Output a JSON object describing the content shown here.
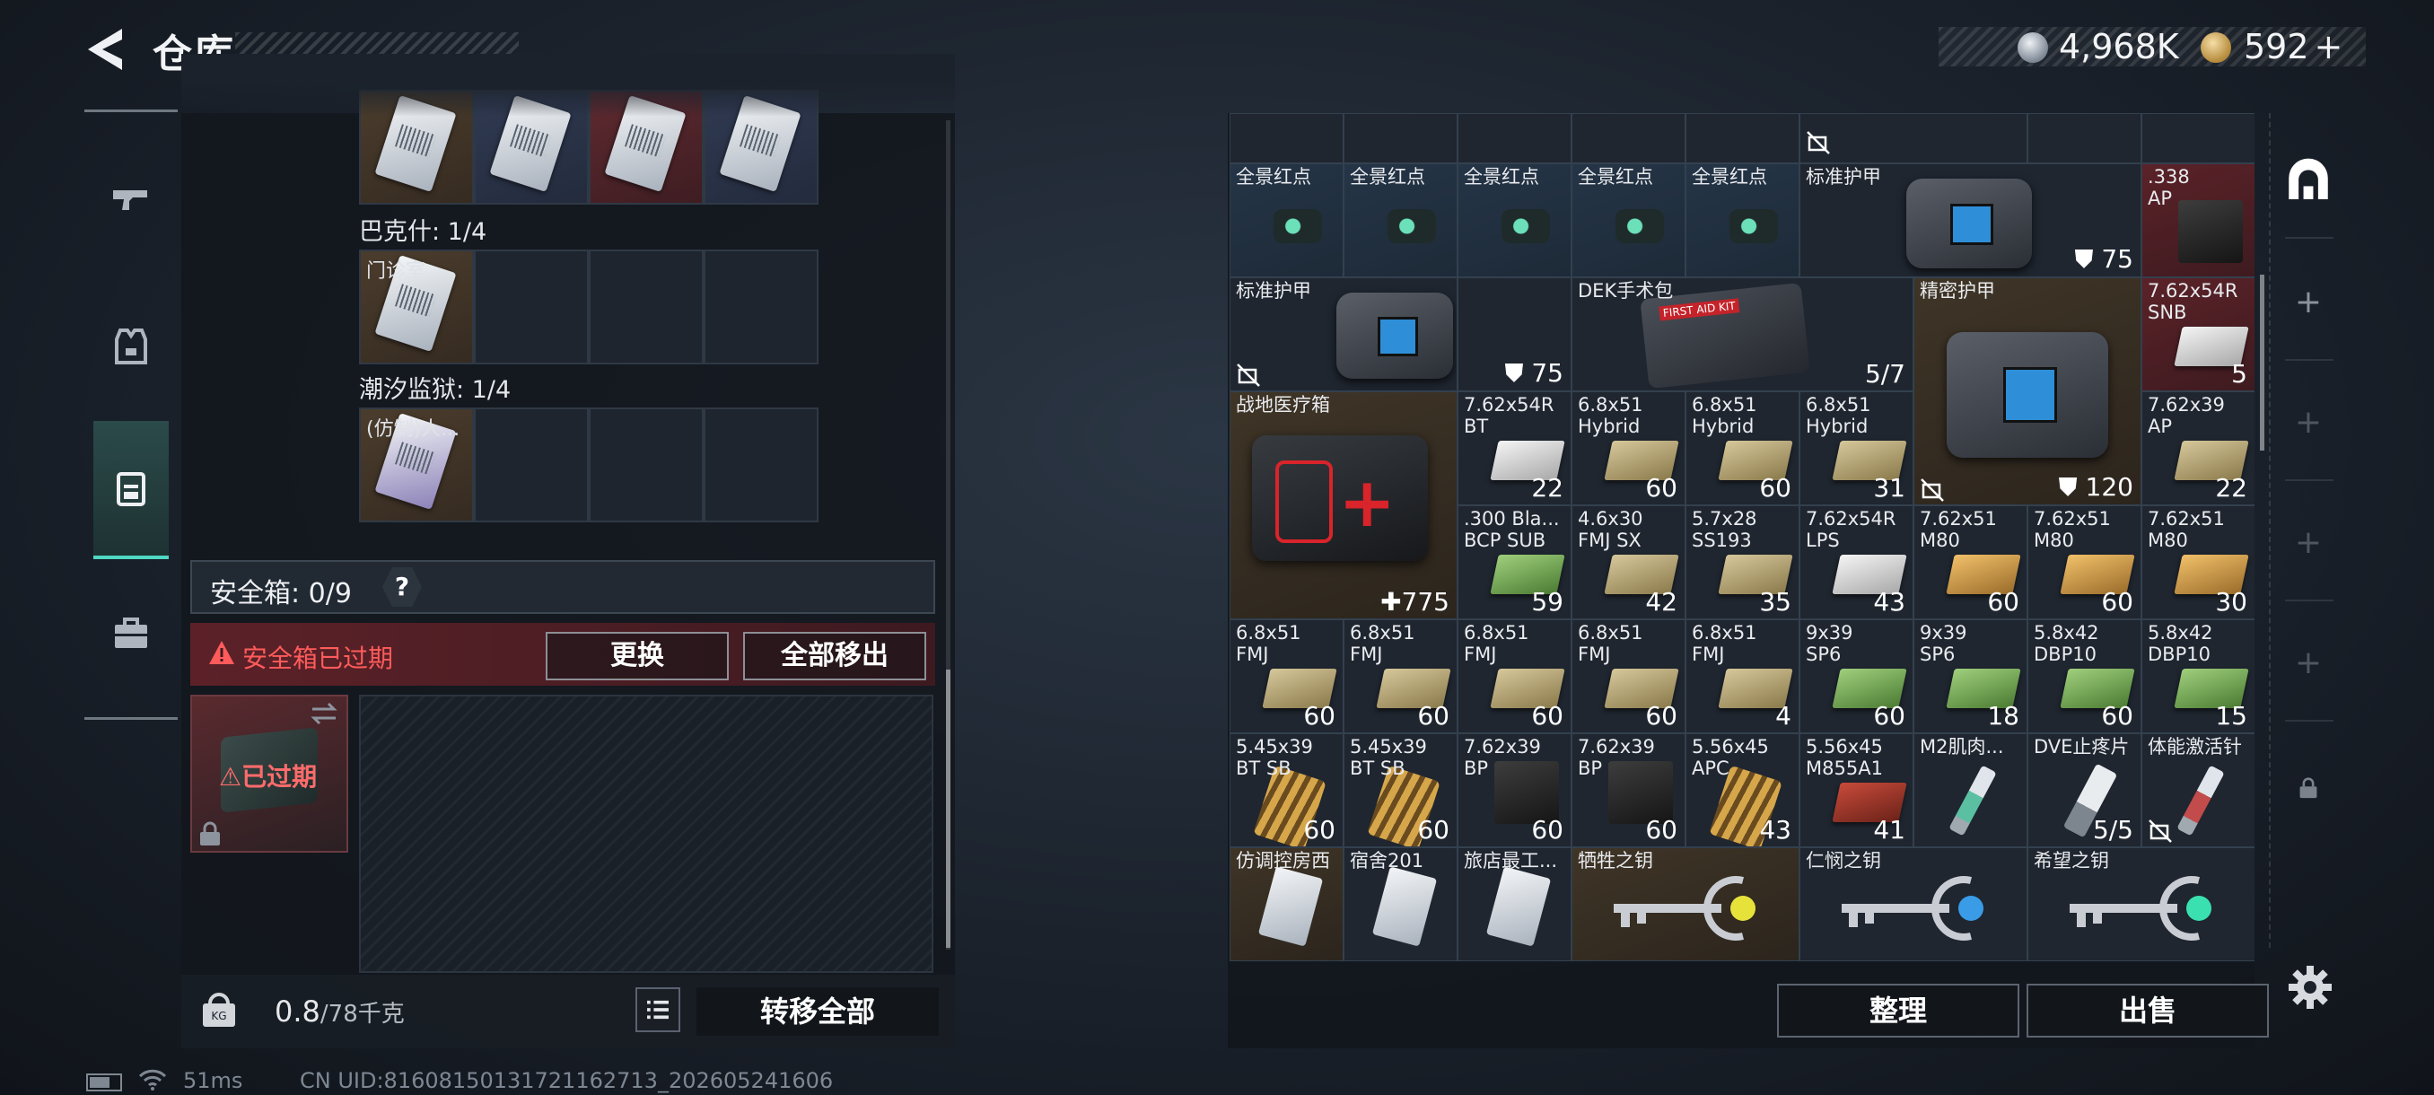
{
  "header": {
    "title": "仓库",
    "currency_1": "4,968K",
    "currency_2": "592",
    "add_symbol": "+"
  },
  "side_tabs": [
    {
      "name": "weapons",
      "icon": "gun-icon"
    },
    {
      "name": "gear",
      "icon": "vest-icon"
    },
    {
      "name": "container",
      "icon": "container-icon",
      "active": true
    },
    {
      "name": "toolbox",
      "icon": "briefcase-icon"
    }
  ],
  "case": {
    "top_row_colors": [
      "brown",
      "blue",
      "red",
      "blue"
    ],
    "groups": [
      {
        "label": "巴克什: 1/4",
        "items": [
          {
            "label": "门诊室"
          }
        ]
      },
      {
        "label": "潮汐监狱: 1/4",
        "items": [
          {
            "label": "(仿制)人..."
          }
        ]
      }
    ],
    "safe_title": "安全箱: 0/9",
    "help": "?",
    "expired_message": "安全箱已过期",
    "replace_label": "更换",
    "move_all_label": "全部移出",
    "safe_item_status": "已过期",
    "weight_value": "0.8",
    "weight_unit": "/78千克",
    "transfer_all_label": "转移全部"
  },
  "status": {
    "ping": "51ms",
    "uid": "CN UID:8160815013172116271​3_202605241606"
  },
  "stash": {
    "sort_label": "整理",
    "sell_label": "出售",
    "scopes": [
      "全景红点",
      "全景红点",
      "全景红点",
      "全景红点",
      "全景红点"
    ],
    "armor_top": {
      "name": "标准护甲",
      "durability": "75"
    },
    "ammo_338": {
      "name": ".338",
      "sub": "AP"
    },
    "armor_mid": {
      "name": "标准护甲",
      "durability": "75"
    },
    "dek": {
      "name": "DEK手术包",
      "count": "5/7"
    },
    "armor_precise": {
      "name": "精密护甲",
      "durability": "120"
    },
    "ammo_762r_snb": {
      "name": "7.62x54R",
      "sub": "SNB",
      "count": "5"
    },
    "medbox": {
      "name": "战地医疗箱",
      "count": "775"
    },
    "row_c": [
      {
        "name": "7.62x54R",
        "sub": "BT",
        "count": "22",
        "box": "white"
      },
      {
        "name": "6.8x51",
        "sub": "Hybrid",
        "count": "60",
        "box": "tan"
      },
      {
        "name": "6.8x51",
        "sub": "Hybrid",
        "count": "60",
        "box": "tan"
      },
      {
        "name": "6.8x51",
        "sub": "Hybrid",
        "count": "31",
        "box": "tan"
      }
    ],
    "ammo_762x39_ap": {
      "name": "7.62x39",
      "sub": "AP",
      "count": "22"
    },
    "row_d": [
      {
        "name": ".300 Bla...",
        "sub": "BCP SUB",
        "count": "59",
        "box": "green"
      },
      {
        "name": "4.6x30",
        "sub": "FMJ SX",
        "count": "42",
        "box": "tan"
      },
      {
        "name": "5.7x28",
        "sub": "SS193",
        "count": "35",
        "box": "tan"
      },
      {
        "name": "7.62x54R",
        "sub": "LPS",
        "count": "43",
        "box": "white"
      },
      {
        "name": "7.62x51",
        "sub": "M80",
        "count": "60",
        "box": "orange"
      },
      {
        "name": "7.62x51",
        "sub": "M80",
        "count": "60",
        "box": "orange"
      },
      {
        "name": "7.62x51",
        "sub": "M80",
        "count": "30",
        "box": "orange"
      }
    ],
    "row_e": [
      {
        "name": "6.8x51",
        "sub": "FMJ",
        "count": "60",
        "box": "tan"
      },
      {
        "name": "6.8x51",
        "sub": "FMJ",
        "count": "60",
        "box": "tan"
      },
      {
        "name": "6.8x51",
        "sub": "FMJ",
        "count": "60",
        "box": "tan"
      },
      {
        "name": "6.8x51",
        "sub": "FMJ",
        "count": "60",
        "box": "tan"
      },
      {
        "name": "6.8x51",
        "sub": "FMJ",
        "count": "4",
        "box": "tan"
      },
      {
        "name": "9x39",
        "sub": "SP6",
        "count": "60",
        "box": "green"
      },
      {
        "name": "9x39",
        "sub": "SP6",
        "count": "18",
        "box": "green"
      },
      {
        "name": "5.8x42",
        "sub": "DBP10",
        "count": "60",
        "box": "green"
      },
      {
        "name": "5.8x42",
        "sub": "DBP10",
        "count": "15",
        "box": "green"
      }
    ],
    "row_f": [
      {
        "name": "5.45x39",
        "sub": "BT SB",
        "count": "60",
        "box": "bullets"
      },
      {
        "name": "5.45x39",
        "sub": "BT SB",
        "count": "60",
        "box": "bullets"
      },
      {
        "name": "7.62x39",
        "sub": "BP",
        "count": "60",
        "box": "dark"
      },
      {
        "name": "7.62x39",
        "sub": "BP",
        "count": "60",
        "box": "dark"
      },
      {
        "name": "5.56x45",
        "sub": "APC",
        "count": "43",
        "box": "bullets"
      },
      {
        "name": "5.56x45",
        "sub": "M855A1",
        "count": "41",
        "box": "redbox"
      },
      {
        "name": "M2肌肉...",
        "sub": "",
        "count": "",
        "box": "syringe"
      },
      {
        "name": "DVE止疼片",
        "sub": "",
        "count": "5/5",
        "box": "syringe"
      },
      {
        "name": "体能激活针",
        "sub": "",
        "count": "",
        "box": "syringe-red"
      }
    ],
    "row_g_cards": [
      {
        "name": "仿调控房西"
      },
      {
        "name": "宿舍201"
      },
      {
        "name": "旅店最工..."
      }
    ],
    "keys": [
      {
        "name": "牺牲之钥",
        "gem": "#e7e23a"
      },
      {
        "name": "仁悯之钥",
        "gem": "#3a9be7"
      },
      {
        "name": "希望之钥",
        "gem": "#3ae0b0"
      }
    ]
  }
}
